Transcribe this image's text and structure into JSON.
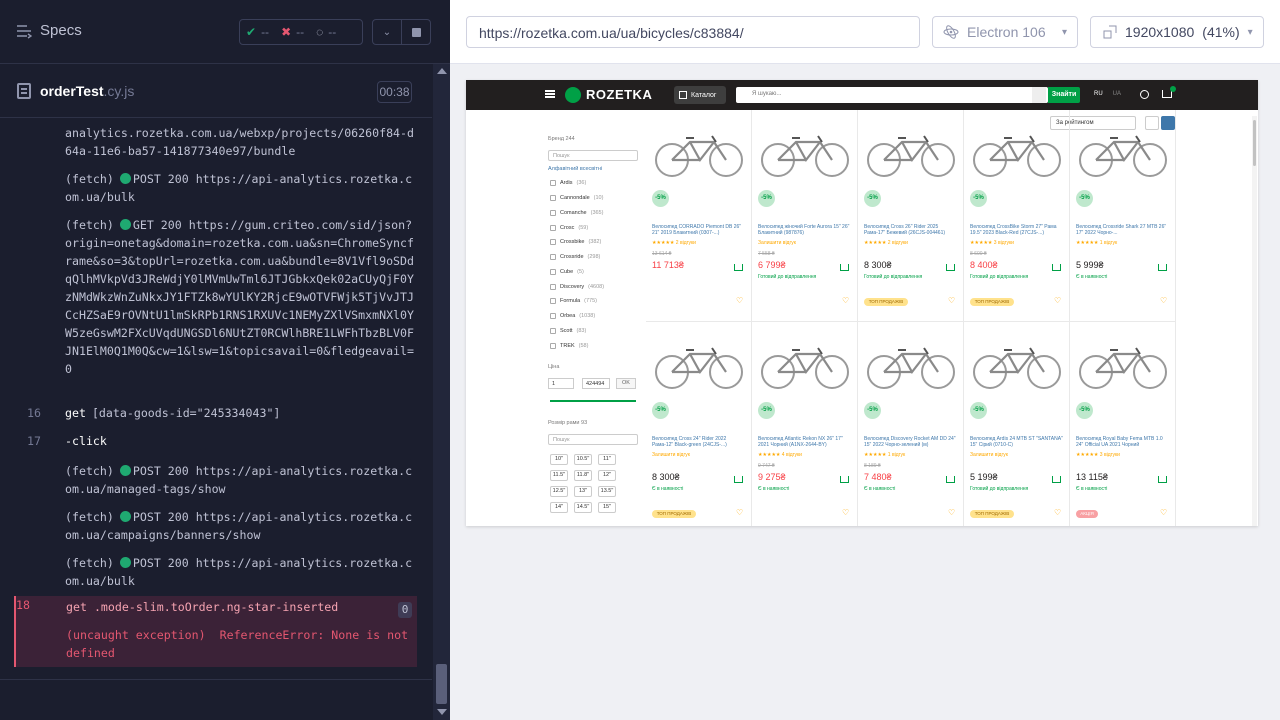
{
  "reporter": {
    "specs_label": "Specs",
    "stats": {
      "passed": "--",
      "failed": "--",
      "pending": "--"
    },
    "spec_file": {
      "name": "orderTest",
      "ext": ".cy.js"
    },
    "duration": "00:38",
    "log": [
      {
        "kind": "text",
        "text": "analytics.rozetka.com.ua/webxp/projects/06260f84-d64a-11e6-ba57-141877340e97/bundle"
      },
      {
        "kind": "fetch",
        "prefix": "(fetch)",
        "text": "POST 200 https://api-analytics.rozetka.com.ua/bulk"
      },
      {
        "kind": "fetch",
        "prefix": "(fetch)",
        "text": "GET 200 https://gum.criteo.com/sid/json?origin=onetag&domain=rozetka.com.ua&sn=ChromeSyncframe&so=3&topUrl=rozetka.com.ua&bundle=8V1Vfl9oSDdqQlhMVkpVd3JReWdjY0lMVmUwTml6JTJGbkxQek02aCUyQjF0YzNMdWkzWnZuNkxJY1FTZk8wYUlKY2RjcE9wOTVFWjk5TjVvJTJCcHZSaE9rOVNtU1lmSkRPb1RNS1RXUVc1NEMyZXlVSmxmNXl0YW5zeGswM2FXcUVqdUNGSDl6NUtZT0RCWlhBRE1LWFhTbzBLV0FJN1ElM0Q1M0Q&cw=1&lsw=1&topicsavail=0&fledgeavail=0"
      },
      {
        "kind": "cmd",
        "num": "16",
        "name": "get",
        "arg": "[data-goods-id=\"245334043\"]"
      },
      {
        "kind": "cmd",
        "num": "17",
        "name": "-click",
        "arg": ""
      },
      {
        "kind": "fetch",
        "prefix": "(fetch)",
        "text": "POST 200 https://api-analytics.rozetka.com.ua/managed-tags/show"
      },
      {
        "kind": "fetch",
        "prefix": "(fetch)",
        "text": "POST 200 https://api-analytics.rozetka.com.ua/campaigns/banners/show"
      },
      {
        "kind": "fetch",
        "prefix": "(fetch)",
        "text": "POST 200 https://api-analytics.rozetka.com.ua/bulk"
      }
    ],
    "error": {
      "num": "18",
      "name": "get",
      "arg": ".mode-slim.toOrder.ng-star-inserted",
      "badge": "0",
      "prefix": "(uncaught exception)",
      "message": "ReferenceError: None is not defined"
    }
  },
  "aut": {
    "url": "https://rozetka.com.ua/ua/bicycles/c83884/",
    "browser": "Electron 106",
    "viewport": "1920x1080",
    "scale": "(41%)",
    "site": {
      "logo": "ROZETKA",
      "catalog": "Каталог",
      "search_placeholder": "Я шукаю...",
      "search_button": "Знайти",
      "lang_ru": "RU",
      "lang_ua": "UA",
      "cart_count": "1",
      "sort": "За рейтингом",
      "filters": {
        "brand_label": "Бренд",
        "brand_count": "244",
        "search_placeholder": "Пошук",
        "alpha_label": "Алфавітний всесвітні",
        "brands": [
          {
            "name": "Ardis",
            "count": "(36)"
          },
          {
            "name": "Cannondale",
            "count": "(10)"
          },
          {
            "name": "Comanche",
            "count": "(365)"
          },
          {
            "name": "Crosс",
            "count": "(59)"
          },
          {
            "name": "Crossbike",
            "count": "(382)"
          },
          {
            "name": "Crossride",
            "count": "(298)"
          },
          {
            "name": "Cube",
            "count": "(5)"
          },
          {
            "name": "Discovery",
            "count": "(4608)"
          },
          {
            "name": "Formula",
            "count": "(775)"
          },
          {
            "name": "Orbea",
            "count": "(1038)"
          },
          {
            "name": "Scott",
            "count": "(83)"
          },
          {
            "name": "TREK",
            "count": "(58)"
          }
        ],
        "price_label": "Ціна",
        "price_min": "1",
        "price_max": "424494",
        "price_ok": "OK",
        "frame_label": "Розмір рами",
        "frame_count": "93",
        "sizes": [
          "10\"",
          "10.5\"",
          "11\"",
          "11.5\"",
          "11.8\"",
          "12\"",
          "12.5\"",
          "13\"",
          "13.5\"",
          "14\"",
          "14.5\"",
          "15\""
        ]
      },
      "products": [
        {
          "title": "Велосипед CORRADO Piemont DB 26\" 21\" 2019 Блакитний (0307-...)",
          "stars": "★★★★★ 2 відгуки",
          "old": "13 614 ₴",
          "price": "11 713₴",
          "red": true,
          "avail": "",
          "promo": ""
        },
        {
          "title": "Велосипед жіночий Forte Aurora 15\" 26\" Блакитний (987876)",
          "stars": "Залишити відгук",
          "old": "7 558 ₴",
          "price": "6 799₴",
          "red": true,
          "avail": "Готовий до відправлення",
          "promo": ""
        },
        {
          "title": "Велосипед Cross 26\" Rider 2025 Рама-17\" Бежевий (26CJS-004461)",
          "stars": "★★★★★ 2 відгуки",
          "old": "",
          "price": "8 300₴",
          "red": false,
          "avail": "Готовий до відправлення",
          "promo": "ТОП ПРОДАЖІВ"
        },
        {
          "title": "Велосипед CrossBike Storm 27\" Рама 19.5\" 2023 Black-Red (27CJS-...)",
          "stars": "★★★★★ 3 відгуки",
          "old": "8 600 ₴",
          "price": "8 400₴",
          "red": true,
          "avail": "Готовий до відправлення",
          "promo": "ТОП ПРОДАЖІВ"
        },
        {
          "title": "Велосипед Crossride Shark 27 MTB 26\" 17\" 2022 Чорно-...",
          "stars": "★★★★★ 1 відгук",
          "old": "",
          "price": "5 999₴",
          "red": false,
          "avail": "Є в наявності",
          "promo": ""
        },
        {
          "title": "Велосипед Cross 24\" Rider 2022 Рама-12\" Black-green (24CJS-...)",
          "stars": "Залишити відгук",
          "old": "",
          "price": "8 300₴",
          "red": false,
          "avail": "Є в наявності",
          "promo": "ТОП ПРОДАЖІВ"
        },
        {
          "title": "Велосипед Atlantic Rekon NX 26\" 17\" 2021 Чорний (A1NX-2644-BY)",
          "stars": "★★★★★ 4 відгуки",
          "old": "9 747 ₴",
          "price": "9 275₴",
          "red": true,
          "avail": "Є в наявності",
          "promo": ""
        },
        {
          "title": "Велосипед Discovery Rocket AM DD 24\" 15\" 2022 Чорно-зелений (м)",
          "stars": "★★★★★ 1 відгук",
          "old": "8 189 ₴",
          "price": "7 480₴",
          "red": true,
          "avail": "Є в наявності",
          "promo": ""
        },
        {
          "title": "Велосипед Ardis 24 MTB ST \"SANTANA\" 15\" Сірий (0710-C)",
          "stars": "Залишити відгук",
          "old": "",
          "price": "5 199₴",
          "red": false,
          "avail": "Готовий до відправлення",
          "promo": "ТОП ПРОДАЖІВ"
        },
        {
          "title": "Велосипед Royal Baby Fema MTB 1.0 24\" Official UA 2021 Чорний",
          "stars": "★★★★★ 3 відгуки",
          "old": "",
          "price": "13 115₴",
          "red": false,
          "avail": "Є в наявності",
          "promo": "АКЦІЯ"
        }
      ]
    }
  }
}
